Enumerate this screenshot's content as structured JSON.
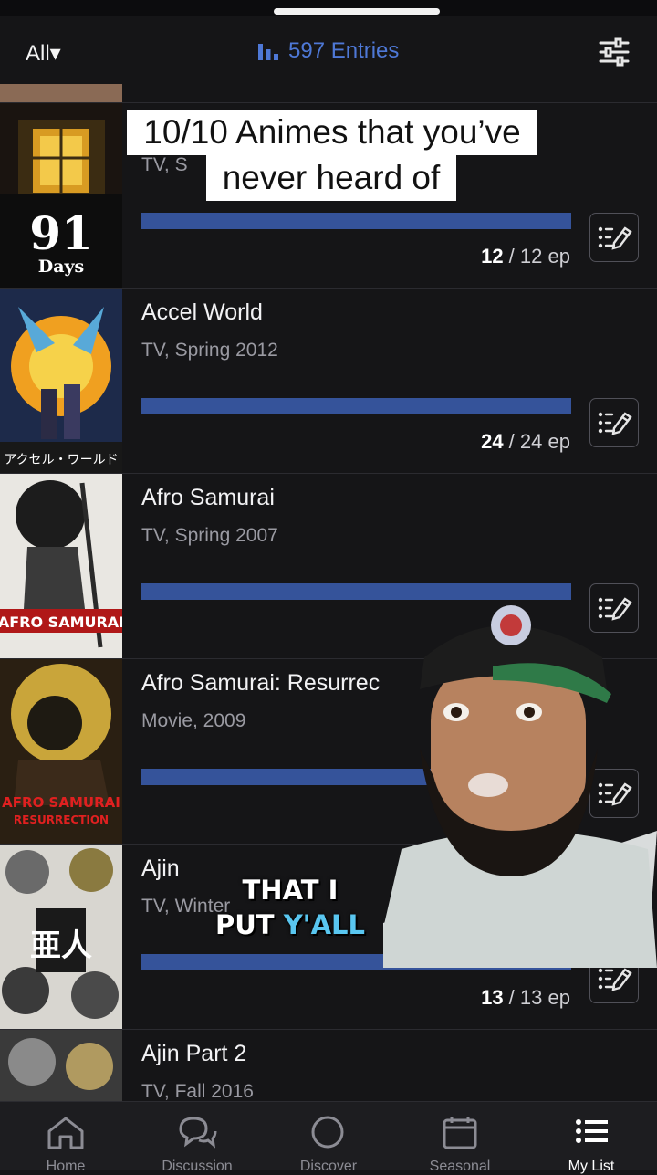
{
  "header": {
    "filter_label": "All▾",
    "entries_label": "597 Entries"
  },
  "caption": {
    "line1": "10/10 Animes that you’ve",
    "line2": "never heard of"
  },
  "subtitle": {
    "line1": "THAT I",
    "line2_a": "PUT ",
    "line2_b": "Y'ALL"
  },
  "list": [
    {
      "title": "",
      "meta": "TV, S",
      "poster_text": "91",
      "poster_text2": "Days",
      "watched": "12",
      "total": "12",
      "unit": "ep",
      "progress": 1.0
    },
    {
      "title": "Accel World",
      "meta": "TV, Spring 2012",
      "poster_text": "アクセル・ワールド",
      "watched": "24",
      "total": "24",
      "unit": "ep",
      "progress": 1.0
    },
    {
      "title": "Afro Samurai",
      "meta": "TV, Spring 2007",
      "poster_text": "AFRO SAMURAI",
      "watched": "",
      "total": "",
      "unit": "ep",
      "progress": 1.0
    },
    {
      "title": "Afro Samurai: Resurrec",
      "meta": "Movie, 2009",
      "poster_text": "AFRO SAMURAI",
      "poster_text2": "RESURRECTION",
      "watched": "",
      "total": "",
      "unit": "",
      "progress": 1.0
    },
    {
      "title": "Ajin",
      "meta": "TV, Winter",
      "poster_text": "亜人",
      "watched": "13",
      "total": "13",
      "unit": "ep",
      "progress": 1.0
    },
    {
      "title": "Ajin Part 2",
      "meta": "TV, Fall 2016",
      "poster_text": "",
      "watched": "",
      "total": "",
      "unit": "",
      "progress": 1.0
    }
  ],
  "tabs": [
    {
      "label": "Home",
      "icon": "home-icon"
    },
    {
      "label": "Discussion",
      "icon": "chat-bubbles-icon"
    },
    {
      "label": "Discover",
      "icon": "search-icon"
    },
    {
      "label": "Seasonal",
      "icon": "calendar-icon"
    },
    {
      "label": "My List",
      "icon": "list-icon",
      "active": true
    }
  ],
  "colors": {
    "accent": "#4e78d6",
    "progress_bar": "#35539a",
    "background": "#151517"
  }
}
